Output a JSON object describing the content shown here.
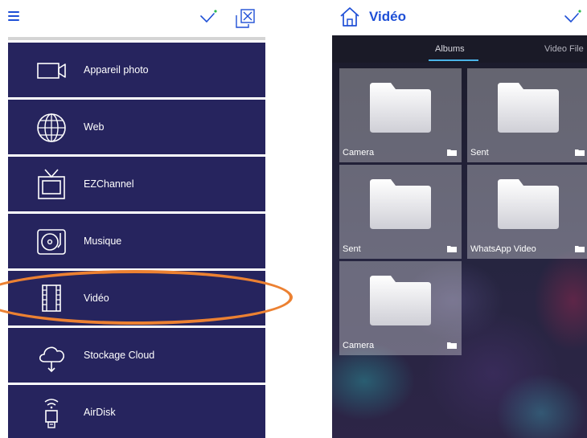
{
  "left_panel": {
    "menu": [
      {
        "label": "Appareil photo",
        "icon": "camera-icon"
      },
      {
        "label": "Web",
        "icon": "globe-icon"
      },
      {
        "label": "EZChannel",
        "icon": "tv-icon"
      },
      {
        "label": "Musique",
        "icon": "music-player-icon"
      },
      {
        "label": "Vidéo",
        "icon": "film-icon"
      },
      {
        "label": "Stockage Cloud",
        "icon": "cloud-icon"
      },
      {
        "label": "AirDisk",
        "icon": "airdisk-icon"
      }
    ],
    "highlighted_item": "Vidéo"
  },
  "right_panel": {
    "title": "Vidéo",
    "tabs": [
      {
        "label": "Albums",
        "active": true
      },
      {
        "label": "Video File",
        "active": false
      }
    ],
    "albums": [
      {
        "name": "Camera"
      },
      {
        "name": "Sent"
      },
      {
        "name": "Sent"
      },
      {
        "name": "WhatsApp Video"
      },
      {
        "name": "Camera"
      }
    ]
  },
  "colors": {
    "accent_blue": "#1e4fd6",
    "menu_bg": "#26245e",
    "highlight_orange": "#ec8132",
    "tab_underline": "#4ab3e8"
  }
}
